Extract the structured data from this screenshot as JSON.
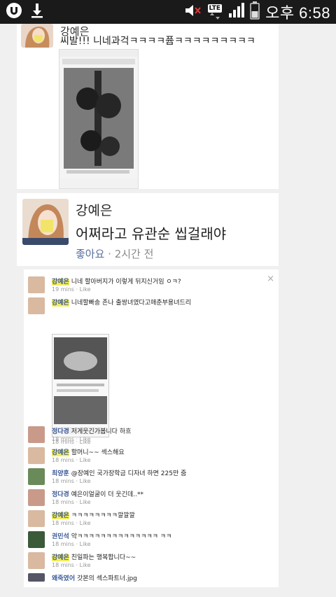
{
  "status_bar": {
    "time": "오후 6:58",
    "network": "LTE",
    "icons": [
      "u-plus-logo-icon",
      "download-icon",
      "mute-icon",
      "lte-icon",
      "signal-icon",
      "battery-icon"
    ]
  },
  "post1": {
    "name": "강예은",
    "text": "씨발!!! 니네과걱ㅋㅋㅋㅋ퓹ㅋㅋㅋㅋㅋㅋㅋㅋㅋ"
  },
  "post2": {
    "name": "강예은",
    "text": "어쩌라고 유관순 씹걸래야",
    "like": "좋아요",
    "sep": " · ",
    "time": "2시간 전"
  },
  "comments": {
    "close": "×",
    "items": [
      {
        "name": "강예은",
        "text": "니네 할아버지가 이렇게 뒤지신거임 ㅇㅋ?",
        "time": "19 mins",
        "like": "Like",
        "highlight": true
      },
      {
        "name": "강예은",
        "text": "니네할빠송 존나 출쌍녀였다고매춘부용녀드리",
        "time": "18 mins",
        "like": "Like",
        "highlight": true
      },
      {
        "name": "정다경",
        "text": "저게웃긴가봅니다 하흐",
        "time": "18 mins",
        "like": "Like",
        "highlight": false
      },
      {
        "name": "강예은",
        "text": "할머니~~ 섹스해요",
        "time": "18 mins",
        "like": "Like",
        "highlight": true
      },
      {
        "name": "최양훈",
        "text": "@장예인 국가장학금 디자녀 하면 225만 줌",
        "time": "18 mins",
        "like": "Like",
        "highlight": false
      },
      {
        "name": "정다경",
        "text": "예은이얼굴이 더 웃긴데..** ",
        "time": "18 mins",
        "like": "Like",
        "highlight": false
      },
      {
        "name": "강예은",
        "text": "ㅋㅋㅋㅋㅋㅋㅋㅋ깔깔깔",
        "time": "18 mins",
        "like": "Like",
        "highlight": true
      },
      {
        "name": "권민석",
        "text": "악ㅋㅋㅋㅋㅋㅋㅋㅋㅋㅋㅋㅋㅋㅋ ㅋㅋ",
        "time": "18 mins",
        "like": "Like",
        "highlight": false
      },
      {
        "name": "강예은",
        "text": "친일파는 행복합니다~~",
        "time": "18 mins",
        "like": "Like",
        "highlight": true
      },
      {
        "name": "왜죽였어",
        "text": "갓본의 섹스파트너.jpg",
        "time": "",
        "like": "",
        "highlight": false
      }
    ]
  }
}
